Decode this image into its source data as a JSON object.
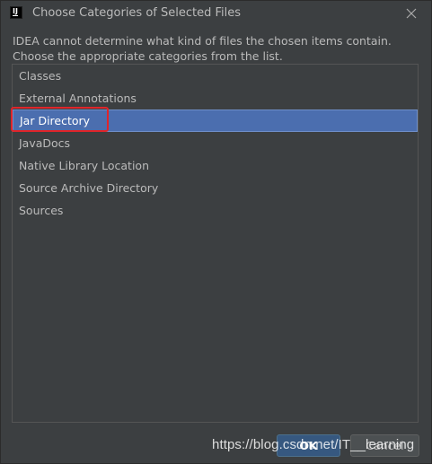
{
  "window": {
    "title": "Choose Categories of Selected Files",
    "app_icon_glyph": "IJ",
    "close_icon": "close-icon"
  },
  "message": {
    "line1": "IDEA cannot determine what kind of files the chosen items contain.",
    "line2": "Choose the appropriate categories from the list."
  },
  "categories": {
    "items": [
      {
        "label": "Classes",
        "selected": false
      },
      {
        "label": "External Annotations",
        "selected": false
      },
      {
        "label": "Jar Directory",
        "selected": true
      },
      {
        "label": "JavaDocs",
        "selected": false
      },
      {
        "label": "Native Library Location",
        "selected": false
      },
      {
        "label": "Source Archive Directory",
        "selected": false
      },
      {
        "label": "Sources",
        "selected": false
      }
    ]
  },
  "buttons": {
    "ok_label": "OK",
    "cancel_label": "Cancel"
  },
  "watermark": "https://blog.csdn.net/IT__learning",
  "colors": {
    "background": "#3c3f41",
    "text": "#bbbbbb",
    "selection": "#4b6eaf",
    "highlight_annotation": "#e0252a",
    "ok_button": "#365880"
  }
}
